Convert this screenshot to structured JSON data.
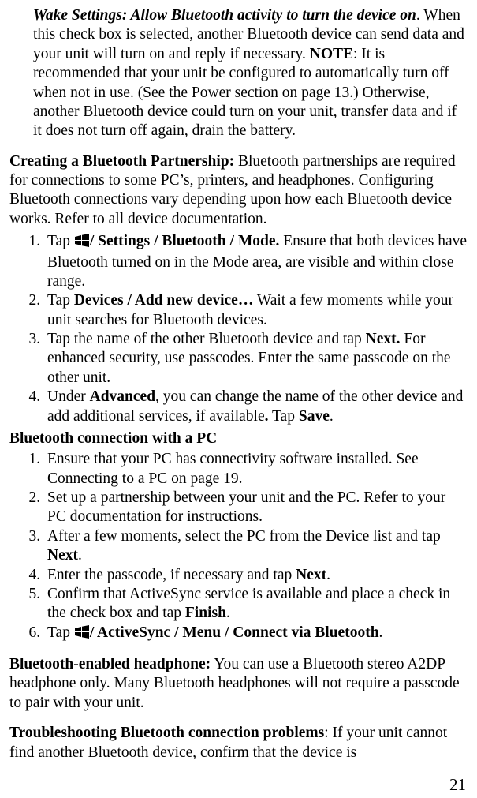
{
  "wake": {
    "heading": "Wake Settings: Allow Bluetooth activity to turn the device on",
    "dot": ". ",
    "sentence1": "When this check box is selected, another Bluetooth device can send data and your unit will turn on and reply if necessary. ",
    "noteLabel": "NOTE",
    "noteBody": ": It is recommended that your unit be configured to automatically turn off when not in use. (See the Power section on page 13.) Otherwise, another Bluetooth device could turn on your unit, transfer data and if it does not turn off again, drain the battery."
  },
  "partner": {
    "heading": "Creating a Bluetooth Partnership:",
    "body": " Bluetooth partnerships are required for connections to some PC’s, printers, and headphones. Configuring Bluetooth connections vary depending upon how each Bluetooth device works. Refer to all device documentation."
  },
  "steps": {
    "s1a": "Tap ",
    "s1path": "/ Settings / Bluetooth / Mode.",
    "s1b": " Ensure that both devices have Bluetooth turned on in the Mode area, are visible and within close range.",
    "s2a": "Tap ",
    "s2path": "Devices / Add new device…",
    "s2b": " Wait a few moments while your unit searches for Bluetooth devices.",
    "s3a": "Tap the name of the other Bluetooth device and tap ",
    "s3bold": "Next.",
    "s3b": " For enhanced security, use passcodes. Enter the same passcode on the other unit.",
    "s4a": "Under ",
    "s4bold1": "Advanced",
    "s4b": ", you can change the name of the other device and add additional services, if available",
    "s4bold2": ".",
    "s4c": " Tap ",
    "s4bold3": "Save",
    "s4d": "."
  },
  "pc": {
    "heading": "Bluetooth connection with a PC",
    "p1": "Ensure that your PC has connectivity software installed. See Connecting to a PC on page 19.",
    "p2": "Set up a partnership between your unit and the PC. Refer to your PC documentation for instructions.",
    "p3a": "After a few moments, select the PC from the Device list and tap ",
    "p3bold": "Next",
    "p3b": ".",
    "p4a": "Enter the passcode, if necessary and tap ",
    "p4bold": "Next",
    "p4b": ".",
    "p5a": "Confirm that ActiveSync service is available and place a check in the check box and tap ",
    "p5bold": "Finish",
    "p5b": ".",
    "p6a": "Tap ",
    "p6path": "/ ActiveSync / Menu / Connect via Bluetooth",
    "p6b": "."
  },
  "headphone": {
    "heading": "Bluetooth-enabled headphone:",
    "body": " You can use a Bluetooth stereo A2DP headphone only. Many Bluetooth headphones will not require a passcode to pair with your unit."
  },
  "trouble": {
    "heading": "Troubleshooting Bluetooth connection problems",
    "body": ": If your unit cannot find another Bluetooth device, confirm that the device is"
  },
  "pageNumber": "21"
}
